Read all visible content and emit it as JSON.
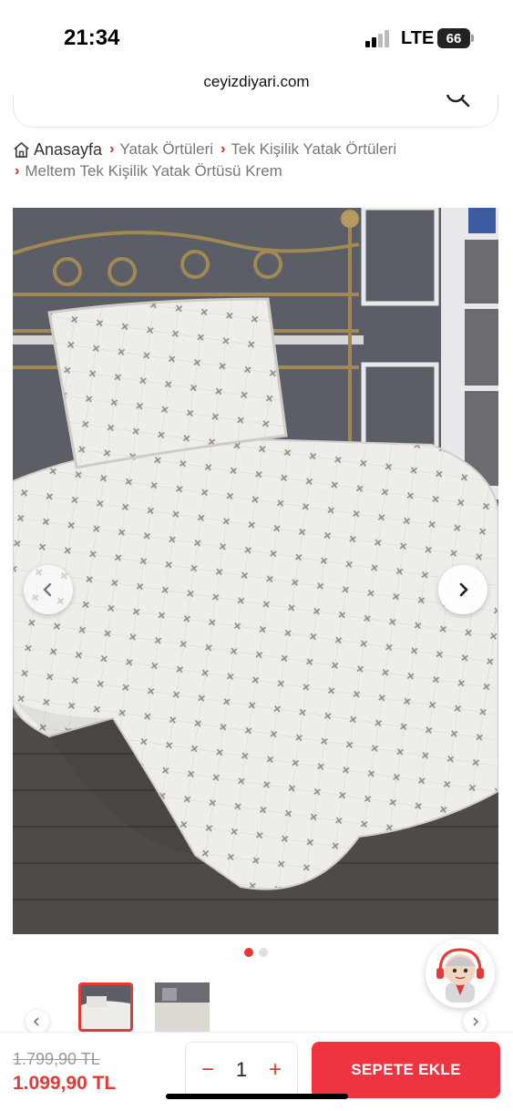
{
  "status_bar": {
    "time": "21:34",
    "network": "LTE",
    "battery": "66"
  },
  "browser": {
    "url": "ceyizdiyari.com"
  },
  "breadcrumb": {
    "home": "Anasayfa",
    "items": [
      "Yatak Örtüleri",
      "Tek Kişilik Yatak Örtüleri",
      "Meltem Tek Kişilik Yatak Örtüsü Krem"
    ],
    "separator": "›"
  },
  "gallery": {
    "active_index": 0,
    "total": 2
  },
  "icons": {
    "home": "home-icon",
    "search": "search-icon",
    "prev": "chevron-left-icon",
    "next": "chevron-right-icon",
    "support": "support-avatar-icon"
  },
  "cart": {
    "old_price": "1.799,90 TL",
    "price": "1.099,90 TL",
    "quantity": "1",
    "minus": "−",
    "plus": "+",
    "add_label": "SEPETE EKLE"
  },
  "colors": {
    "accent": "#ef3340",
    "price": "#e53935"
  }
}
